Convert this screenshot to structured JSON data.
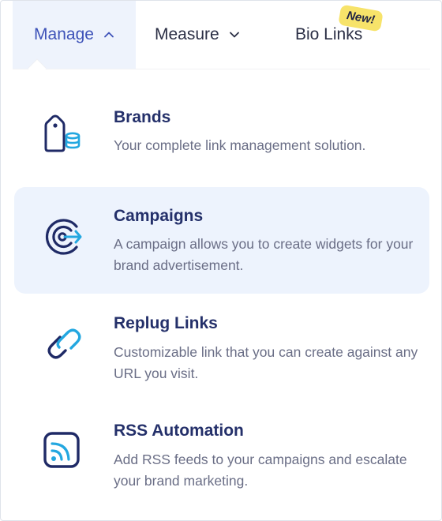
{
  "nav": {
    "manage_label": "Manage",
    "measure_label": "Measure",
    "bio_links_label": "Bio Links",
    "new_badge": "New!"
  },
  "menu": {
    "items": [
      {
        "title": "Brands",
        "description": "Your complete link management solution.",
        "icon": "brand-tag-icon"
      },
      {
        "title": "Campaigns",
        "description": "A campaign allows you to create widgets for your brand advertisement.",
        "icon": "campaign-target-icon"
      },
      {
        "title": "Replug Links",
        "description": "Customizable link that you can create against any URL you visit.",
        "icon": "link-chain-icon"
      },
      {
        "title": "RSS Automation",
        "description": "Add RSS feeds to your campaigns and escalate your brand marketing.",
        "icon": "rss-feed-icon"
      }
    ]
  },
  "colors": {
    "accent": "#3d52b8",
    "title": "#24306a",
    "icon_dark": "#1f2a66",
    "icon_accent": "#23a7e0",
    "highlight_bg": "#edf3fd",
    "badge_bg": "#f7e36a"
  }
}
